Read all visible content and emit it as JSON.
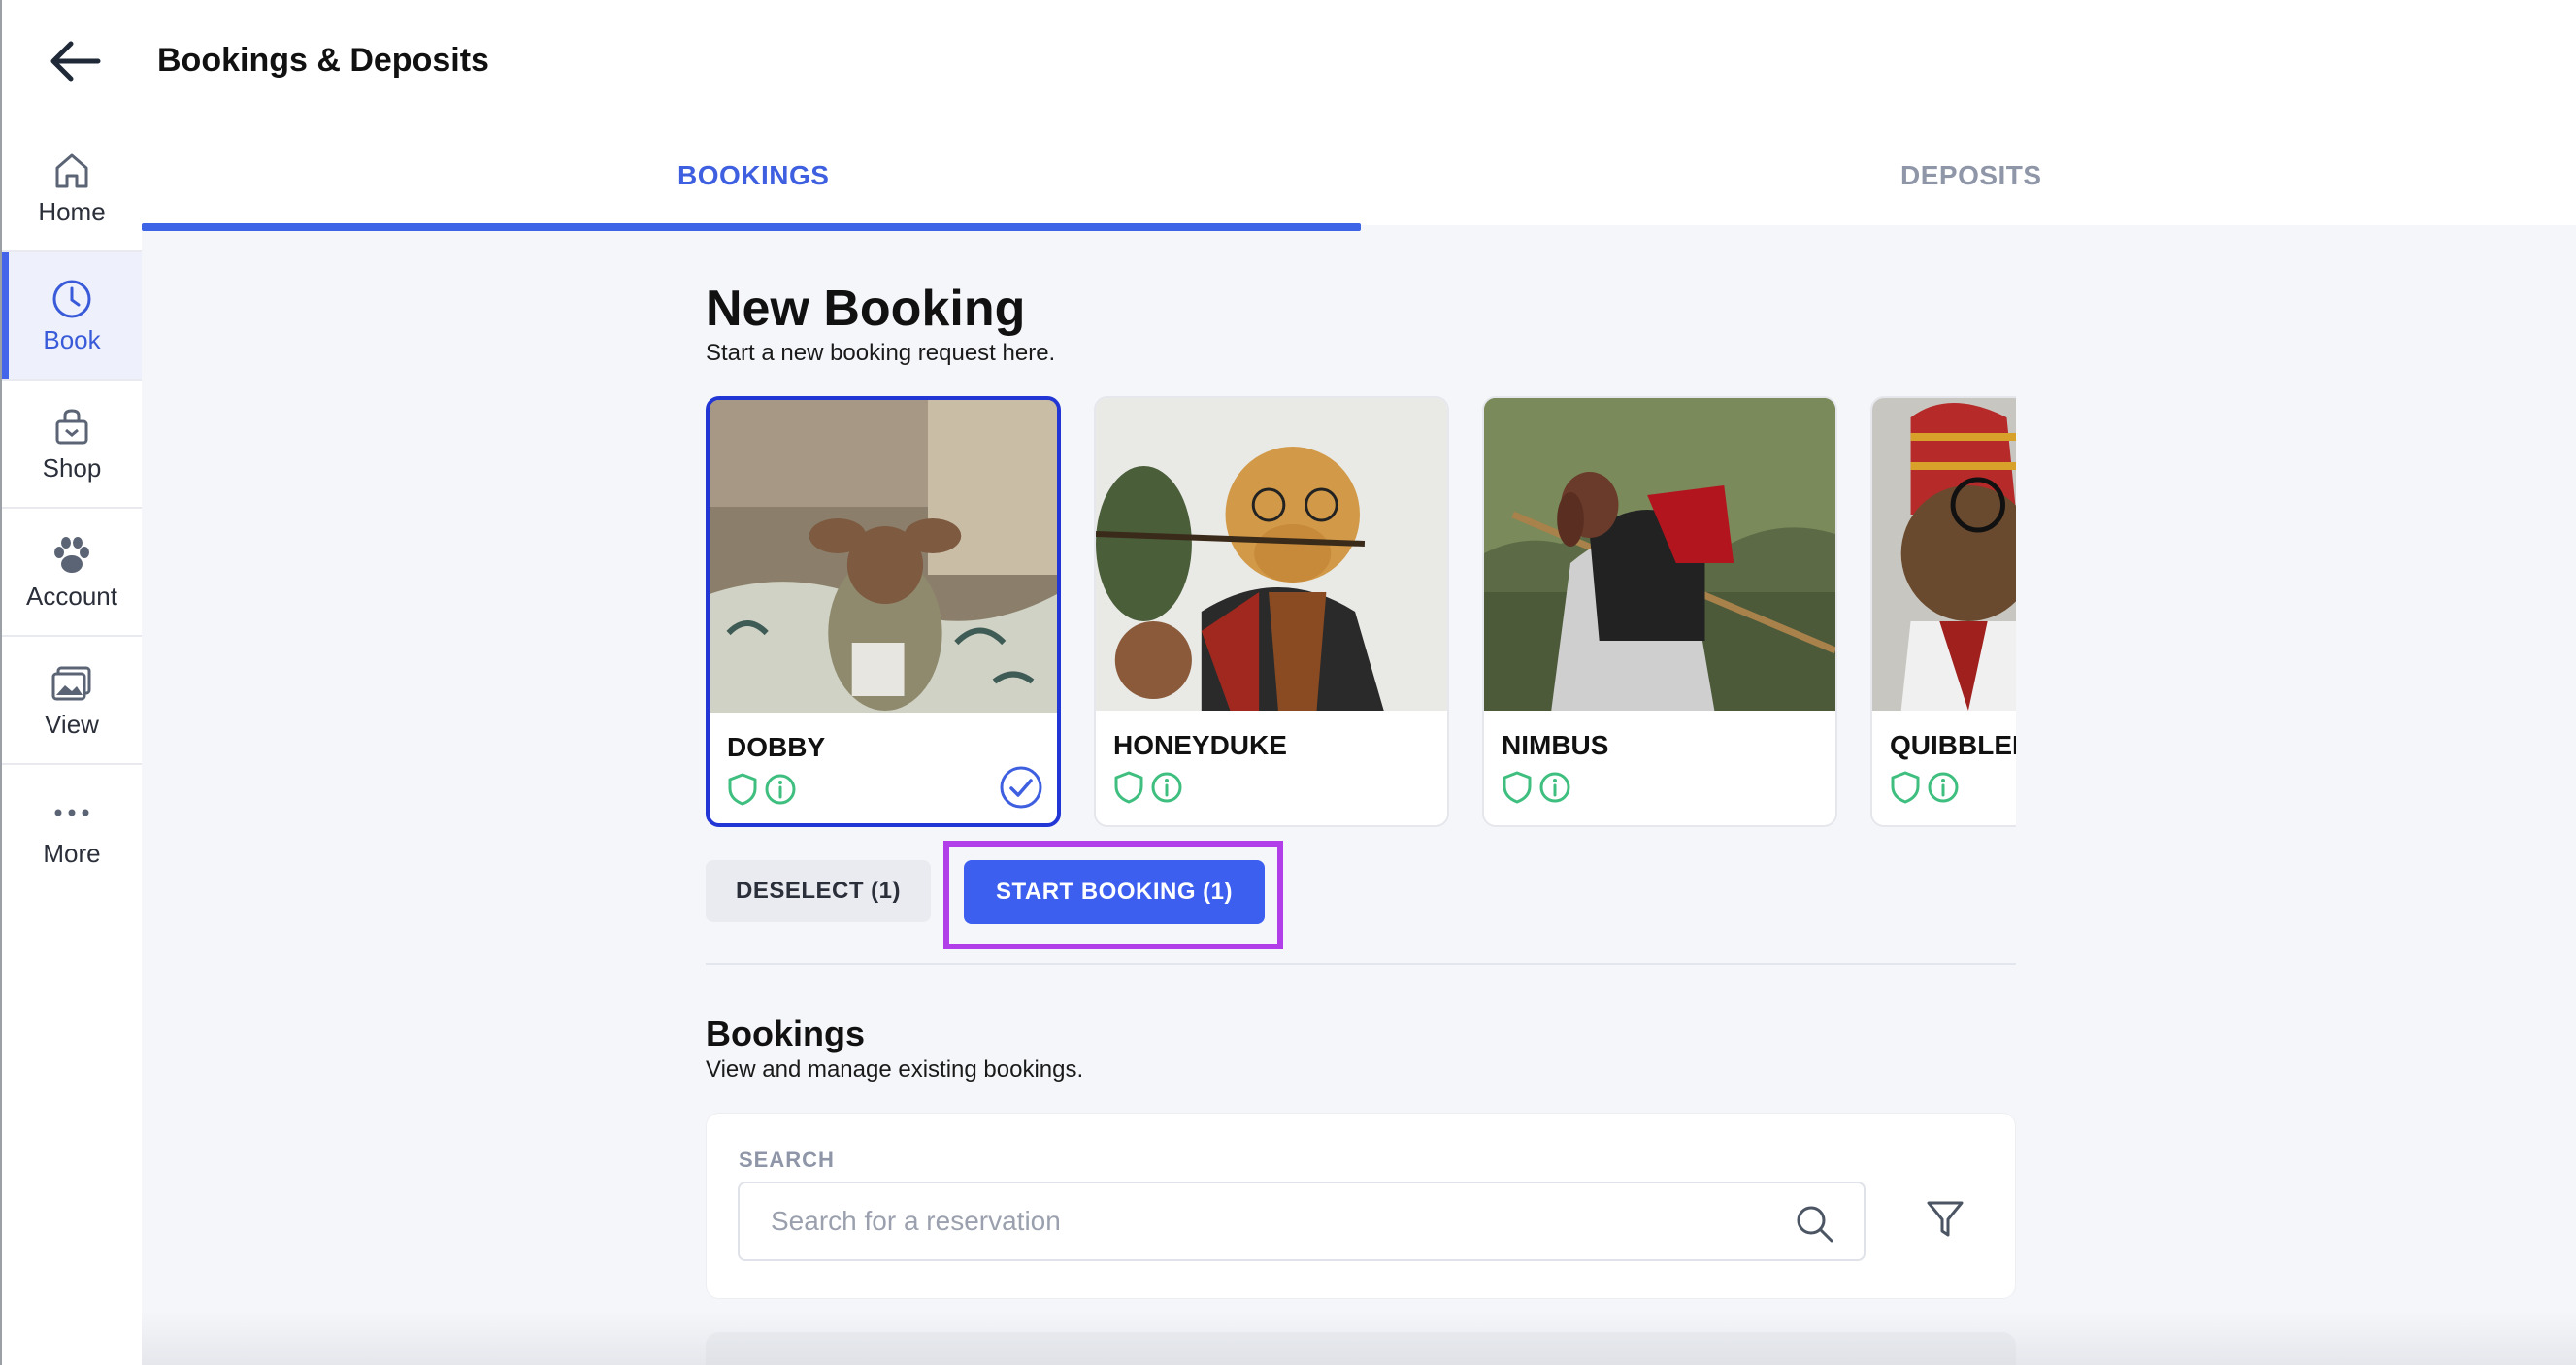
{
  "header": {
    "title": "Bookings & Deposits",
    "back_icon": "arrow-left-icon"
  },
  "sidebar": {
    "items": [
      {
        "label": "Home",
        "icon": "home-icon",
        "active": false
      },
      {
        "label": "Book",
        "icon": "clock-icon",
        "active": true
      },
      {
        "label": "Shop",
        "icon": "shopping-bag-icon",
        "active": false
      },
      {
        "label": "Account",
        "icon": "paw-icon",
        "active": false
      },
      {
        "label": "View",
        "icon": "image-gallery-icon",
        "active": false
      },
      {
        "label": "More",
        "icon": "more-dots-icon",
        "active": false
      }
    ]
  },
  "tabs": [
    {
      "label": "BOOKINGS",
      "active": true
    },
    {
      "label": "DEPOSITS",
      "active": false
    }
  ],
  "new_booking": {
    "title": "New Booking",
    "subtitle": "Start a new booking request here.",
    "pets": [
      {
        "name": "DOBBY",
        "selected": true
      },
      {
        "name": "HONEYDUKE",
        "selected": false
      },
      {
        "name": "NIMBUS",
        "selected": false
      },
      {
        "name": "QUIBBLER",
        "selected": false
      }
    ],
    "deselect_label": "DESELECT (1)",
    "start_label": "START BOOKING (1)"
  },
  "bookings": {
    "title": "Bookings",
    "subtitle": "View and manage existing bookings.",
    "search_label": "SEARCH",
    "search_placeholder": "Search for a reservation",
    "search_value": ""
  },
  "colors": {
    "accent": "#3d5ff0",
    "selected_border": "#2236d6",
    "highlight": "#b13ee8",
    "badge_green": "#3fbf7f"
  }
}
